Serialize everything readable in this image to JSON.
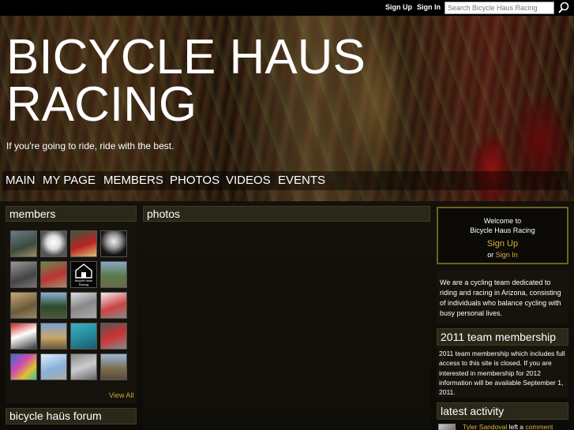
{
  "topbar": {
    "sign_up": "Sign Up",
    "sign_in": "Sign In",
    "search_placeholder": "Search Bicycle Haus Racing",
    "search_icon": "search-icon"
  },
  "header": {
    "title_line1": "BICYCLE HAUS",
    "title_line2": "RACING",
    "tagline": "If you're going to ride, ride with the best."
  },
  "nav": {
    "items": [
      "MAIN",
      "MY PAGE",
      "MEMBERS",
      "PHOTOS",
      "VIDEOS",
      "EVENTS"
    ]
  },
  "members": {
    "heading": "members",
    "thumbnail_count": 20,
    "view_all": "View All",
    "logo_text_line1": "bicycle haus",
    "logo_text_line2": "Racing"
  },
  "photos": {
    "heading": "photos"
  },
  "forum": {
    "heading": "bicycle haüs forum"
  },
  "welcome": {
    "line1": "Welcome to",
    "line2": "Bicycle Haus Racing",
    "sign_up": "Sign Up",
    "or": "or",
    "sign_in": "Sign In"
  },
  "about": {
    "text": "We are a cycling team dedicated to riding and racing in Arizona, consisting of individuals who balance cycling with busy personal lives."
  },
  "membership": {
    "heading": "2011 team membership",
    "text": "2011 team membership which includes full access to this site is closed.  If you are interested in membership for 2012 information will be available September 1, 2011."
  },
  "activity": {
    "heading": "latest activity",
    "user": "Tyler Sandoval",
    "action": "left a",
    "link": "comment"
  },
  "colors": {
    "accent": "#d8b23a",
    "panel_header": "#2a2818",
    "welcome_border": "#6a6420"
  }
}
